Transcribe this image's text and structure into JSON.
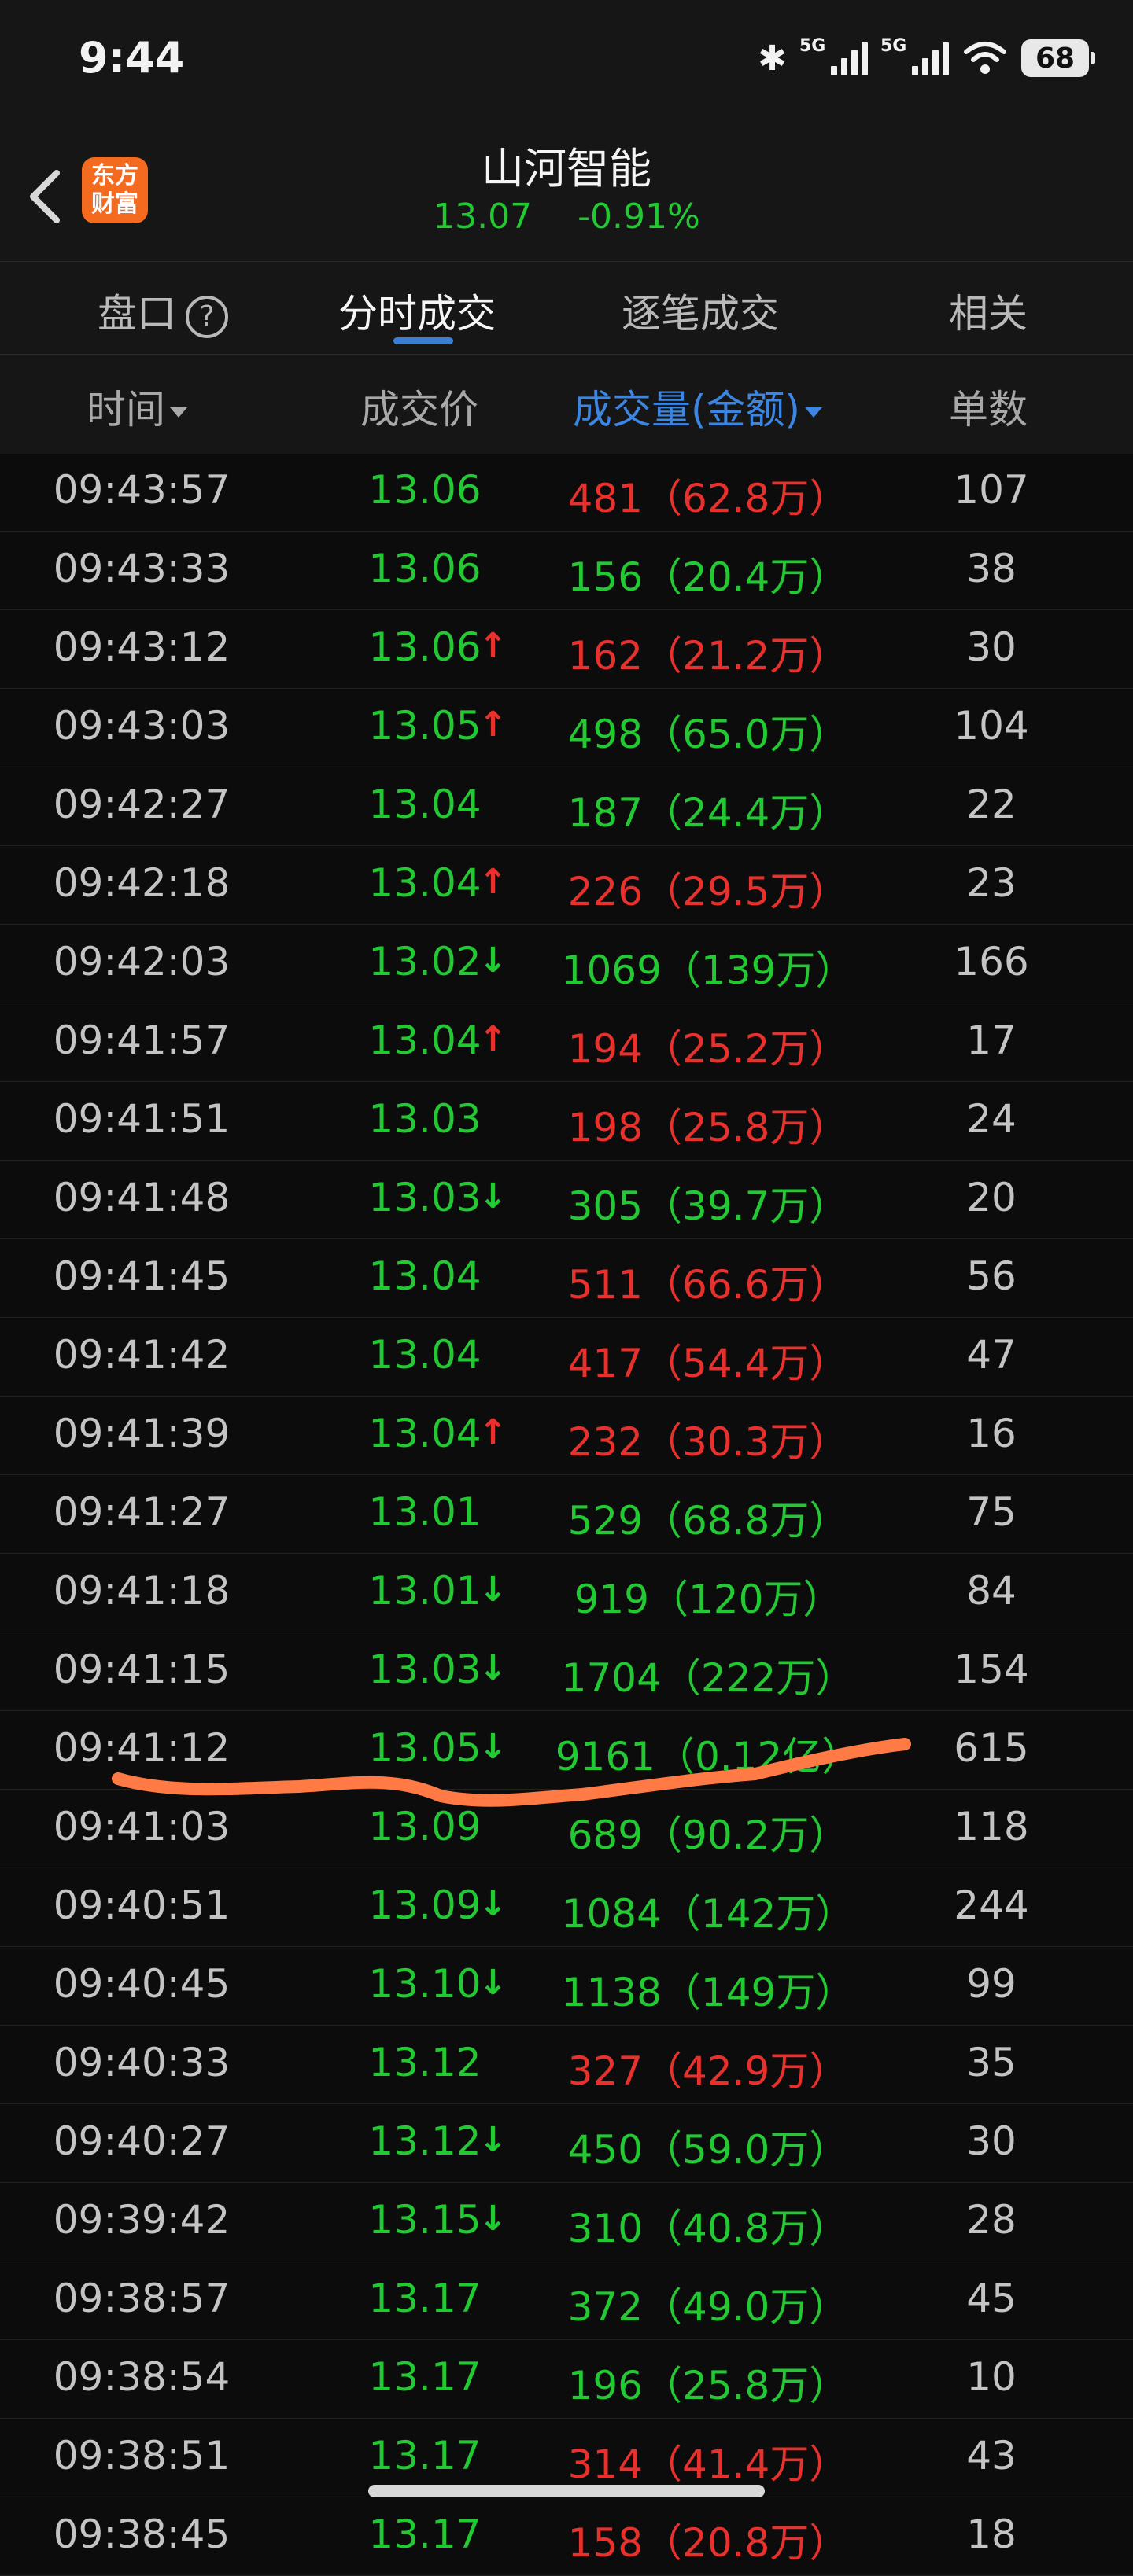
{
  "status_bar": {
    "time": "9:44",
    "network1": "5G",
    "network2": "5G",
    "battery": "68"
  },
  "header": {
    "logo_line1": "东方",
    "logo_line2": "财富",
    "stock_name": "山河智能",
    "price": "13.07",
    "change": "-0.91%"
  },
  "tabs": [
    {
      "label": "盘口"
    },
    {
      "label": "分时成交"
    },
    {
      "label": "逐笔成交"
    },
    {
      "label": "相关"
    }
  ],
  "columns": {
    "time": "时间",
    "price": "成交价",
    "volume": "成交量(金额)",
    "count": "单数"
  },
  "colors": {
    "up": "#e8312c",
    "down": "#22c932",
    "accent": "#3b86e3",
    "brand": "#f46a1e",
    "annotation": "#ff7a45"
  },
  "rows": [
    {
      "time": "09:43:57",
      "price": "13.06",
      "arrow": "",
      "volume": "481（62.8万）",
      "vol_color": "red",
      "count": "107"
    },
    {
      "time": "09:43:33",
      "price": "13.06",
      "arrow": "",
      "volume": "156（20.4万）",
      "vol_color": "green",
      "count": "38"
    },
    {
      "time": "09:43:12",
      "price": "13.06",
      "arrow": "↑",
      "volume": "162（21.2万）",
      "vol_color": "red",
      "count": "30"
    },
    {
      "time": "09:43:03",
      "price": "13.05",
      "arrow": "↑",
      "volume": "498（65.0万）",
      "vol_color": "green",
      "count": "104"
    },
    {
      "time": "09:42:27",
      "price": "13.04",
      "arrow": "",
      "volume": "187（24.4万）",
      "vol_color": "green",
      "count": "22"
    },
    {
      "time": "09:42:18",
      "price": "13.04",
      "arrow": "↑",
      "volume": "226（29.5万）",
      "vol_color": "red",
      "count": "23"
    },
    {
      "time": "09:42:03",
      "price": "13.02",
      "arrow": "↓",
      "volume": "1069（139万）",
      "vol_color": "green",
      "count": "166"
    },
    {
      "time": "09:41:57",
      "price": "13.04",
      "arrow": "↑",
      "volume": "194（25.2万）",
      "vol_color": "red",
      "count": "17"
    },
    {
      "time": "09:41:51",
      "price": "13.03",
      "arrow": "",
      "volume": "198（25.8万）",
      "vol_color": "red",
      "count": "24"
    },
    {
      "time": "09:41:48",
      "price": "13.03",
      "arrow": "↓",
      "volume": "305（39.7万）",
      "vol_color": "green",
      "count": "20"
    },
    {
      "time": "09:41:45",
      "price": "13.04",
      "arrow": "",
      "volume": "511（66.6万）",
      "vol_color": "red",
      "count": "56"
    },
    {
      "time": "09:41:42",
      "price": "13.04",
      "arrow": "",
      "volume": "417（54.4万）",
      "vol_color": "red",
      "count": "47"
    },
    {
      "time": "09:41:39",
      "price": "13.04",
      "arrow": "↑",
      "volume": "232（30.3万）",
      "vol_color": "red",
      "count": "16"
    },
    {
      "time": "09:41:27",
      "price": "13.01",
      "arrow": "",
      "volume": "529（68.8万）",
      "vol_color": "green",
      "count": "75"
    },
    {
      "time": "09:41:18",
      "price": "13.01",
      "arrow": "↓",
      "volume": "919（120万）",
      "vol_color": "green",
      "count": "84"
    },
    {
      "time": "09:41:15",
      "price": "13.03",
      "arrow": "↓",
      "volume": "1704（222万）",
      "vol_color": "green",
      "count": "154"
    },
    {
      "time": "09:41:12",
      "price": "13.05",
      "arrow": "↓",
      "volume": "9161（0.12亿）",
      "vol_color": "green",
      "count": "615"
    },
    {
      "time": "09:41:03",
      "price": "13.09",
      "arrow": "",
      "volume": "689（90.2万）",
      "vol_color": "green",
      "count": "118"
    },
    {
      "time": "09:40:51",
      "price": "13.09",
      "arrow": "↓",
      "volume": "1084（142万）",
      "vol_color": "green",
      "count": "244"
    },
    {
      "time": "09:40:45",
      "price": "13.10",
      "arrow": "↓",
      "volume": "1138（149万）",
      "vol_color": "green",
      "count": "99"
    },
    {
      "time": "09:40:33",
      "price": "13.12",
      "arrow": "",
      "volume": "327（42.9万）",
      "vol_color": "red",
      "count": "35"
    },
    {
      "time": "09:40:27",
      "price": "13.12",
      "arrow": "↓",
      "volume": "450（59.0万）",
      "vol_color": "green",
      "count": "30"
    },
    {
      "time": "09:39:42",
      "price": "13.15",
      "arrow": "↓",
      "volume": "310（40.8万）",
      "vol_color": "green",
      "count": "28"
    },
    {
      "time": "09:38:57",
      "price": "13.17",
      "arrow": "",
      "volume": "372（49.0万）",
      "vol_color": "green",
      "count": "45"
    },
    {
      "time": "09:38:54",
      "price": "13.17",
      "arrow": "",
      "volume": "196（25.8万）",
      "vol_color": "green",
      "count": "10"
    },
    {
      "time": "09:38:51",
      "price": "13.17",
      "arrow": "",
      "volume": "314（41.4万）",
      "vol_color": "red",
      "count": "43"
    },
    {
      "time": "09:38:45",
      "price": "13.17",
      "arrow": "",
      "volume": "158（20.8万）",
      "vol_color": "red",
      "count": "18"
    }
  ]
}
